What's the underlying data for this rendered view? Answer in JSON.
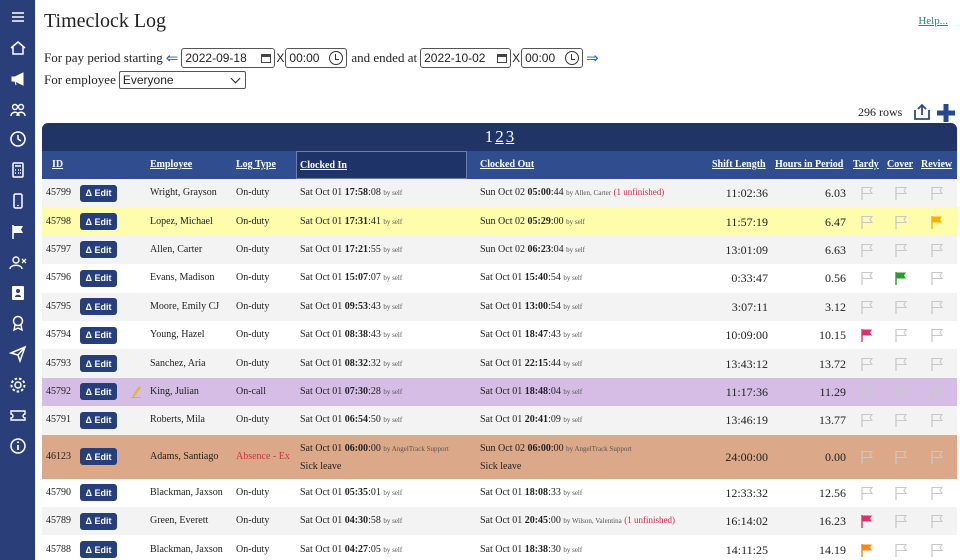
{
  "page": {
    "title": "Timeclock Log",
    "help_label": "Help...",
    "pay_period_label": "For pay period starting",
    "ended_label": "and ended at",
    "employee_label": "For employee",
    "start_date": "2022-09-18",
    "start_time": "00:00",
    "end_date": "2022-10-02",
    "end_time": "00:00",
    "time_sep": "X",
    "employee_select": "Everyone",
    "row_count": "296 rows",
    "pages": [
      "1",
      "2",
      "3"
    ]
  },
  "columns": {
    "id": "ID",
    "employee": "Employee",
    "log_type": "Log Type",
    "clocked_in": "Clocked In",
    "clocked_out": "Clocked Out",
    "shift_length": "Shift Length",
    "hours_in_period": "Hours in Period",
    "tardy": "Tardy",
    "cover": "Cover",
    "review": "Review"
  },
  "edit_label": "Δ Edit",
  "rows": [
    {
      "id": "45799",
      "employee": "Wright, Grayson",
      "log_type": "On-duty",
      "in_prefix": "Sat Oct 01 ",
      "in_bold": "17:58",
      "in_suffix": ":08",
      "in_by": "by self",
      "out_prefix": "Sun Oct 02 ",
      "out_bold": "05:00",
      "out_suffix": ":44",
      "out_by": "by Allen, Carter",
      "out_warn": "(1 unfinished)",
      "shift": "11:02:36",
      "hours": "6.03",
      "tardy": "gray",
      "cover": "gray",
      "review": "gray",
      "bg": "#f3f3f3"
    },
    {
      "id": "45798",
      "employee": "Lopez, Michael",
      "log_type": "On-duty",
      "in_prefix": "Sat Oct 01 ",
      "in_bold": "17:31",
      "in_suffix": ":41",
      "in_by": "by self",
      "out_prefix": "Sun Oct 02 ",
      "out_bold": "05:29",
      "out_suffix": ":00",
      "out_by": "by self",
      "out_warn": "",
      "shift": "11:57:19",
      "hours": "6.47",
      "tardy": "gray",
      "cover": "gray",
      "review": "gold",
      "bg": "#fdfdab"
    },
    {
      "id": "45797",
      "employee": "Allen, Carter",
      "log_type": "On-duty",
      "in_prefix": "Sat Oct 01 ",
      "in_bold": "17:21",
      "in_suffix": ":55",
      "in_by": "by self",
      "out_prefix": "Sun Oct 02 ",
      "out_bold": "06:23",
      "out_suffix": ":04",
      "out_by": "by self",
      "out_warn": "",
      "shift": "13:01:09",
      "hours": "6.63",
      "tardy": "gray",
      "cover": "gray",
      "review": "gray",
      "bg": "#f3f3f3"
    },
    {
      "id": "45796",
      "employee": "Evans, Madison",
      "log_type": "On-duty",
      "in_prefix": "Sat Oct 01 ",
      "in_bold": "15:07",
      "in_suffix": ":07",
      "in_by": "by self",
      "out_prefix": "Sat Oct 01 ",
      "out_bold": "15:40",
      "out_suffix": ":54",
      "out_by": "by self",
      "out_warn": "",
      "shift": "0:33:47",
      "hours": "0.56",
      "tardy": "gray",
      "cover": "green",
      "review": "gray",
      "bg": "#ffffff"
    },
    {
      "id": "45795",
      "employee": "Moore, Emily CJ",
      "log_type": "On-duty",
      "in_prefix": "Sat Oct 01 ",
      "in_bold": "09:53",
      "in_suffix": ":43",
      "in_by": "by self",
      "out_prefix": "Sat Oct 01 ",
      "out_bold": "13:00",
      "out_suffix": ":54",
      "out_by": "by self",
      "out_warn": "",
      "shift": "3:07:11",
      "hours": "3.12",
      "tardy": "gray",
      "cover": "gray",
      "review": "gray",
      "bg": "#f3f3f3"
    },
    {
      "id": "45794",
      "employee": "Young, Hazel",
      "log_type": "On-duty",
      "in_prefix": "Sat Oct 01 ",
      "in_bold": "08:38",
      "in_suffix": ":43",
      "in_by": "by self",
      "out_prefix": "Sat Oct 01 ",
      "out_bold": "18:47",
      "out_suffix": ":43",
      "out_by": "by self",
      "out_warn": "",
      "shift": "10:09:00",
      "hours": "10.15",
      "tardy": "red",
      "cover": "gray",
      "review": "gray",
      "bg": "#ffffff"
    },
    {
      "id": "45793",
      "employee": "Sanchez, Aria",
      "log_type": "On-duty",
      "in_prefix": "Sat Oct 01 ",
      "in_bold": "08:32",
      "in_suffix": ":32",
      "in_by": "by self",
      "out_prefix": "Sat Oct 01 ",
      "out_bold": "22:15",
      "out_suffix": ":44",
      "out_by": "by self",
      "out_warn": "",
      "shift": "13:43:12",
      "hours": "13.72",
      "tardy": "gray",
      "cover": "gray",
      "review": "gray",
      "bg": "#f3f3f3"
    },
    {
      "id": "45792",
      "employee": "King, Julian",
      "log_type": "On-call",
      "in_prefix": "Sat Oct 01 ",
      "in_bold": "07:30",
      "in_suffix": ":28",
      "in_by": "by self",
      "out_prefix": "Sat Oct 01 ",
      "out_bold": "18:48",
      "out_suffix": ":04",
      "out_by": "by self",
      "out_warn": "",
      "shift": "11:17:36",
      "hours": "11.29",
      "tardy": "gray",
      "cover": "gray",
      "review": "gray",
      "bg": "#d5bde5",
      "pencil": true
    },
    {
      "id": "45791",
      "employee": "Roberts, Mila",
      "log_type": "On-duty",
      "in_prefix": "Sat Oct 01 ",
      "in_bold": "06:54",
      "in_suffix": ":50",
      "in_by": "by self",
      "out_prefix": "Sat Oct 01 ",
      "out_bold": "20:41",
      "out_suffix": ":09",
      "out_by": "by self",
      "out_warn": "",
      "shift": "13:46:19",
      "hours": "13.77",
      "tardy": "gray",
      "cover": "gray",
      "review": "gray",
      "bg": "#f3f3f3"
    },
    {
      "id": "46123",
      "employee": "Adams, Santiago",
      "log_type": "Absence - Ex",
      "in_prefix": "Sat Oct 01 ",
      "in_bold": "06:00",
      "in_suffix": ":00",
      "in_by": "by AngelTrack Support",
      "out_prefix": "Sun Oct 02 ",
      "out_bold": "06:00",
      "out_suffix": ":00",
      "out_by": "by AngelTrack Support",
      "out_warn": "",
      "note_in": "Sick leave",
      "note_out": "Sick leave",
      "shift": "24:00:00",
      "hours": "0.00",
      "tardy": "gray",
      "cover": "gray",
      "review": "gray",
      "bg": "#dba98a",
      "tall": true
    },
    {
      "id": "45790",
      "employee": "Blackman, Jaxson",
      "log_type": "On-duty",
      "in_prefix": "Sat Oct 01 ",
      "in_bold": "05:35",
      "in_suffix": ":01",
      "in_by": "by self",
      "out_prefix": "Sat Oct 01 ",
      "out_bold": "18:08",
      "out_suffix": ":33",
      "out_by": "by self",
      "out_warn": "",
      "shift": "12:33:32",
      "hours": "12.56",
      "tardy": "gray",
      "cover": "gray",
      "review": "gray",
      "bg": "#ffffff"
    },
    {
      "id": "45789",
      "employee": "Green, Everett",
      "log_type": "On-duty",
      "in_prefix": "Sat Oct 01 ",
      "in_bold": "04:30",
      "in_suffix": ":58",
      "in_by": "by self",
      "out_prefix": "Sat Oct 01 ",
      "out_bold": "20:45",
      "out_suffix": ":00",
      "out_by": "by Wilson, Valentina",
      "out_warn": "(1 unfinished)",
      "shift": "16:14:02",
      "hours": "16.23",
      "tardy": "red",
      "cover": "gray",
      "review": "gray",
      "bg": "#f3f3f3"
    },
    {
      "id": "45788",
      "employee": "Blackman, Jaxson",
      "log_type": "On-duty",
      "in_prefix": "Sat Oct 01 ",
      "in_bold": "04:27",
      "in_suffix": ":05",
      "in_by": "by self",
      "out_prefix": "Sat Oct 01 ",
      "out_bold": "18:38",
      "out_suffix": ":30",
      "out_by": "by self",
      "out_warn": "",
      "shift": "14:11:25",
      "hours": "14.19",
      "tardy": "orange",
      "cover": "gray",
      "review": "gray",
      "bg": "#ffffff"
    }
  ],
  "colors": {
    "sidebar": "#2a3f7a",
    "header_dark": "#203566",
    "header": "#2f4d8f",
    "edit_button": "#263e7a",
    "flag_gray": "#c8c8c8",
    "flag_gold": "#f2b400",
    "flag_green": "#2e9a2e",
    "flag_red": "#e0306a",
    "flag_orange": "#f08a1c"
  },
  "icons": [
    "menu-icon",
    "home-icon",
    "megaphone-icon",
    "people-icon",
    "clock-icon",
    "calculator-icon",
    "phone-icon",
    "flag-icon",
    "user-x-icon",
    "id-card-icon",
    "award-icon",
    "send-icon",
    "gear-icon",
    "ticket-icon",
    "info-icon"
  ]
}
